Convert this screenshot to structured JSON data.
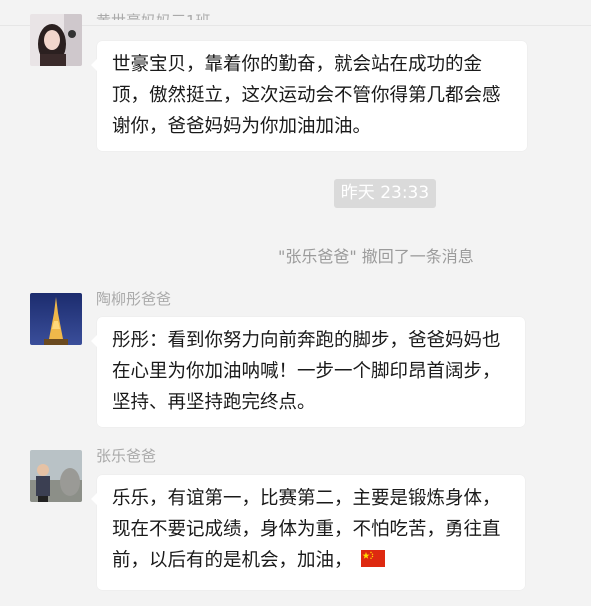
{
  "messages": [
    {
      "sender": "黄世豪妈妈三1班",
      "text": "世豪宝贝，靠着你的勤奋，就会站在成功的金顶，傲然挺立，这次运动会不管你得第几都会感谢你，爸爸妈妈为你加油加油。"
    },
    {
      "sender": "陶柳彤爸爸",
      "text": "彤彤：看到你努力向前奔跑的脚步，爸爸妈妈也在心里为你加油呐喊！一步一个脚印昂首阔步，坚持、再坚持跑完终点。"
    },
    {
      "sender": "张乐爸爸",
      "text": "乐乐，有谊第一，比赛第二，主要是锻炼身体，现在不要记成绩，身体为重，不怕吃苦，勇往直前，以后有的是机会，加油，",
      "emoji": "china-flag"
    }
  ],
  "timestamp": "昨天 23:33",
  "recall_notice": "\"张乐爸爸\" 撤回了一条消息",
  "colors": {
    "background": "#f3f3f3",
    "bubble": "#ffffff",
    "timestamp_bg": "#dadada",
    "sender_name": "#aaaaaa",
    "flag_red": "#de2910",
    "flag_star": "#ffde00"
  }
}
